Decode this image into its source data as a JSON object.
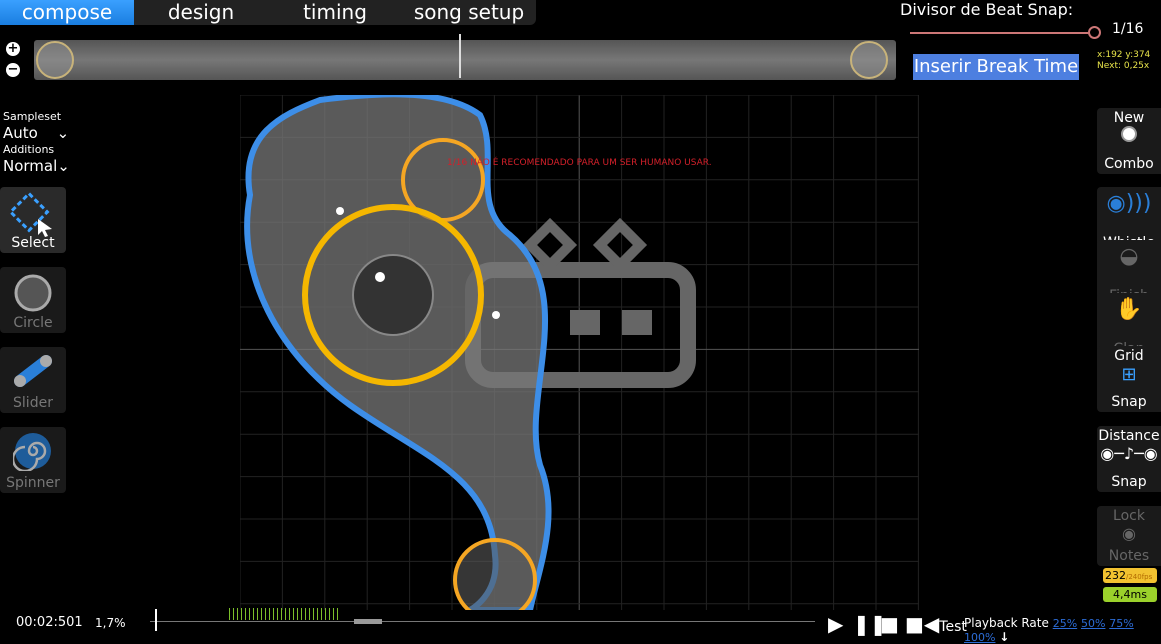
{
  "tabs": [
    {
      "label": "compose",
      "active": true
    },
    {
      "label": "design"
    },
    {
      "label": "timing"
    },
    {
      "label": "song setup"
    }
  ],
  "snap": {
    "label": "Divisor de Beat Snap:",
    "value": "1/16"
  },
  "break_button": "Inserir Break Time",
  "coords": {
    "pos": "x:192 y:374",
    "next": "Next: 0,25x"
  },
  "left": {
    "sampleset_label": "Sampleset",
    "sampleset": "Auto",
    "additions_label": "Additions",
    "additions": "Normal",
    "tools": [
      "Select",
      "Circle",
      "Slider",
      "Spinner"
    ]
  },
  "right": {
    "new_combo": [
      "New",
      "Combo"
    ],
    "whistle": "Whistle",
    "finish": "Finish",
    "clap": "Clap",
    "grid": [
      "Grid",
      "Snap"
    ],
    "distance": [
      "Distance",
      "Snap"
    ],
    "lock": [
      "Lock",
      "Notes"
    ]
  },
  "warning": "1/16 NÃO É RECOMENDADO PARA UM SER HUMANO USAR.",
  "status": {
    "time": "00:02:501",
    "percent": "1,7%"
  },
  "perf": {
    "fps": "232",
    "fps_max": "/240fps",
    "ms": "4,4ms"
  },
  "playback": {
    "test": "Test",
    "label": "Playback Rate",
    "rates": [
      "25%",
      "50%",
      "75%",
      "100%"
    ]
  },
  "colors": {
    "accent": "#1e90ff",
    "slider_border": "#3d8ee8",
    "hit_circle": "#f5b700",
    "warning": "#d2202a"
  }
}
